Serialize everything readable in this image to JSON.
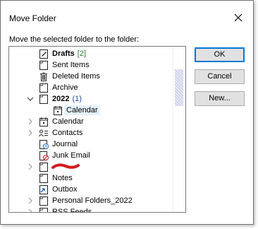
{
  "dialog": {
    "title": "Move Folder",
    "prompt": "Move the selected folder to the folder:"
  },
  "buttons": {
    "ok": "OK",
    "cancel": "Cancel",
    "new": "New..."
  },
  "colors": {
    "accent": "#0078d7",
    "count_green": "#2e7d32",
    "count_blue": "#1f4fa0",
    "redaction": "#d11b1b",
    "selection": "#e5f1fb"
  },
  "tree": {
    "items": [
      {
        "label": "Drafts",
        "count": "[2]",
        "icon": "drafts-folder-icon",
        "bold": true,
        "chevron": "none"
      },
      {
        "label": "Sent Items",
        "icon": "folder-icon",
        "bold": false,
        "chevron": "none"
      },
      {
        "label": "Deleted Items",
        "icon": "trash-icon",
        "bold": false,
        "chevron": "none"
      },
      {
        "label": "Archive",
        "icon": "folder-icon",
        "bold": false,
        "chevron": "none"
      },
      {
        "label": "2022",
        "count": "(1)",
        "icon": "folder-icon",
        "bold": true,
        "chevron": "expanded"
      },
      {
        "label": "Calendar",
        "icon": "calendar-icon",
        "bold": false,
        "chevron": "none",
        "selected": true
      },
      {
        "label": "Calendar",
        "icon": "calendar-icon",
        "bold": false,
        "chevron": "collapsed"
      },
      {
        "label": "Contacts",
        "icon": "contacts-icon",
        "bold": false,
        "chevron": "collapsed"
      },
      {
        "label": "Journal",
        "icon": "journal-icon",
        "bold": false,
        "chevron": "none"
      },
      {
        "label": "Junk Email",
        "icon": "junk-icon",
        "bold": false,
        "chevron": "none"
      },
      {
        "label": "",
        "icon": "folder-icon",
        "bold": false,
        "chevron": "collapsed",
        "redacted": true
      },
      {
        "label": "Notes",
        "icon": "folder-icon",
        "bold": false,
        "chevron": "none"
      },
      {
        "label": "Outbox",
        "icon": "outbox-icon",
        "bold": false,
        "chevron": "none"
      },
      {
        "label": "Personal Folders_2022",
        "icon": "folder-icon",
        "bold": false,
        "chevron": "collapsed"
      },
      {
        "label": "RSS Feeds",
        "icon": "folder-icon",
        "bold": false,
        "chevron": "collapsed"
      }
    ]
  }
}
